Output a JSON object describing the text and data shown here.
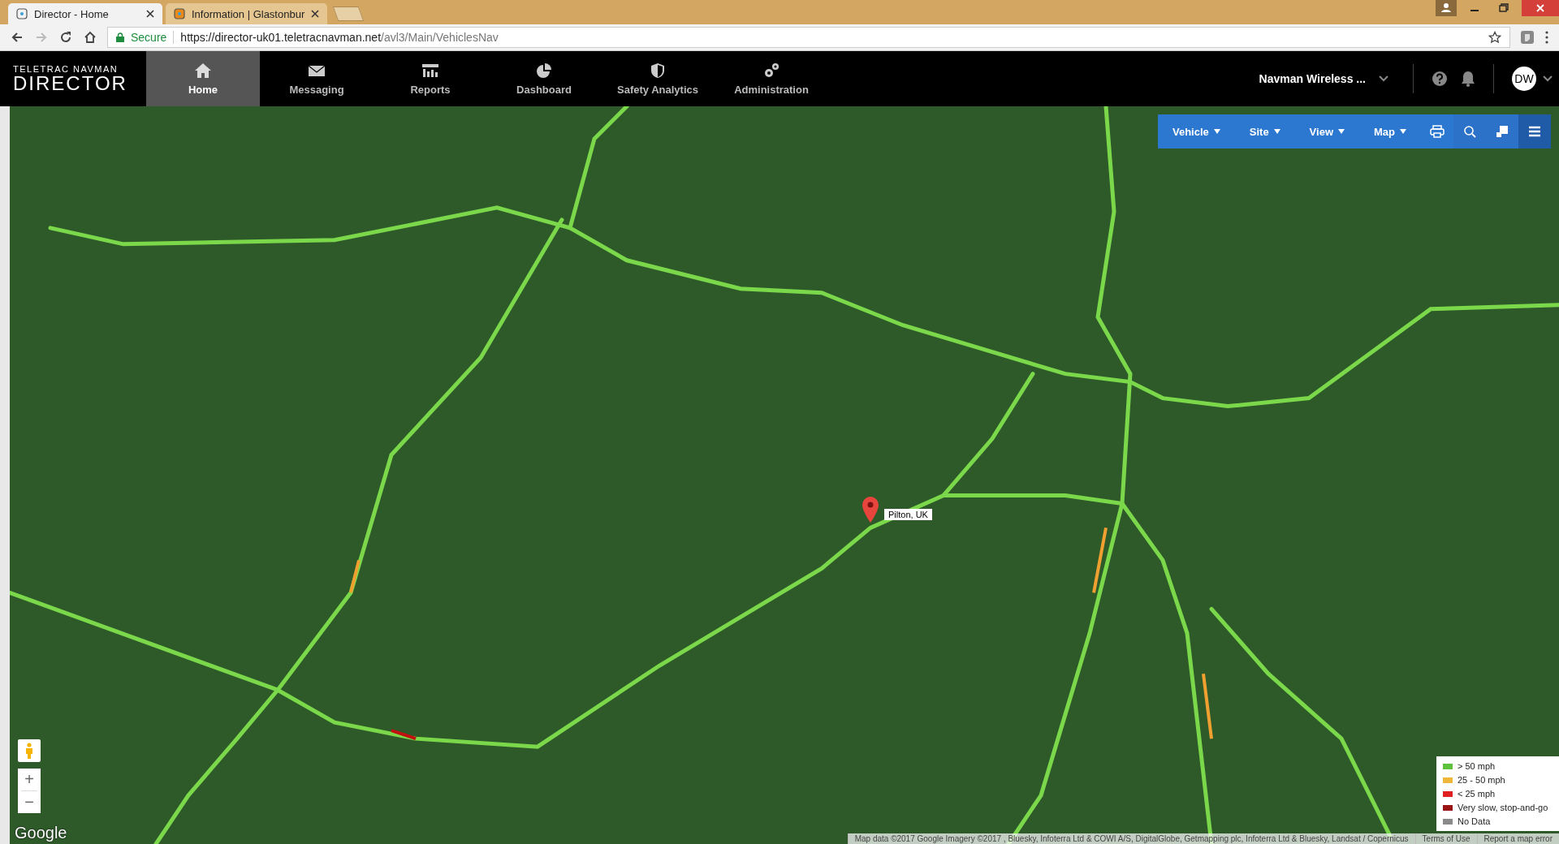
{
  "browser": {
    "tabs": [
      {
        "title": "Director - Home",
        "selected": true
      },
      {
        "title": "Information | Glastonbur",
        "selected": false
      }
    ],
    "address": {
      "secure_label": "Secure",
      "host": "https://director-uk01.teletracnavman.net",
      "path": "/avl3/Main/VehiclesNav"
    }
  },
  "header": {
    "logo": {
      "line1": "TELETRAC NAVMAN",
      "line2": "DIRECTOR"
    },
    "nav": [
      {
        "label": "Home",
        "kind": "home",
        "selected": true
      },
      {
        "label": "Messaging",
        "kind": "mail",
        "selected": false
      },
      {
        "label": "Reports",
        "kind": "reports",
        "selected": false
      },
      {
        "label": "Dashboard",
        "kind": "pie",
        "selected": false
      },
      {
        "label": "Safety Analytics",
        "kind": "shield",
        "selected": false
      },
      {
        "label": "Administration",
        "kind": "gears",
        "selected": false
      }
    ],
    "account": "Navman Wireless ...",
    "avatar": "DW"
  },
  "map": {
    "toolbar": [
      "Vehicle",
      "Site",
      "View",
      "Map"
    ],
    "pin_label": "Pilton, UK",
    "zoom_in": "+",
    "zoom_out": "−",
    "google": "Google",
    "attribution": "Map data ©2017 Google Imagery ©2017 , Bluesky, Infoterra Ltd & COWI A/S, DigitalGlobe, Getmapping plc, Infoterra Ltd & Bluesky, Landsat / Copernicus",
    "links": [
      "Terms of Use",
      "Report a map error"
    ],
    "legend": [
      {
        "label": "> 50 mph",
        "color": "#5cc23c"
      },
      {
        "label": "25 - 50 mph",
        "color": "#f0b63a"
      },
      {
        "label": "< 25 mph",
        "color": "#e02020"
      },
      {
        "label": "Very slow, stop-and-go",
        "color": "#9a1414"
      },
      {
        "label": "No Data",
        "color": "#8a8a8a"
      }
    ]
  }
}
